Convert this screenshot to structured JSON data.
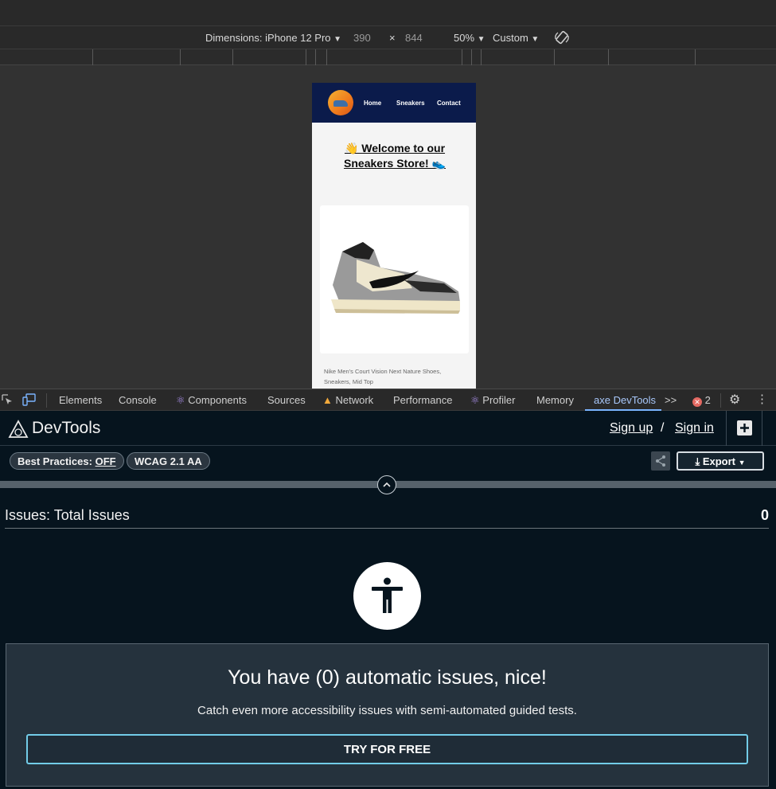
{
  "device_toolbar": {
    "dimensions_label": "Dimensions: iPhone 12 Pro",
    "width": "390",
    "times": "×",
    "height": "844",
    "zoom": "50%",
    "throttle": "Custom"
  },
  "site": {
    "nav": [
      "Home",
      "Sneakers",
      "Contact"
    ],
    "welcome_line1": "👋 Welcome to our",
    "welcome_line2": "Sneakers Store! 👟",
    "product_caption": "Nike Men's Court Vision Next Nature Shoes, Sneakers, Mid Top"
  },
  "devtools_tabs": {
    "items": [
      "Elements",
      "Console",
      "Components",
      "Sources",
      "Network",
      "Performance",
      "Profiler",
      "Memory",
      "axe DevTools"
    ],
    "active": "axe DevTools",
    "more": ">>",
    "error_count": "2"
  },
  "axe": {
    "title": "DevTools",
    "sign_up": "Sign up",
    "slash": "/",
    "sign_in": "Sign in",
    "best_practices_label": "Best Practices:",
    "best_practices_value": "OFF",
    "wcag": "WCAG 2.1 AA",
    "export": "Export",
    "issues_label": "Issues: Total Issues",
    "issues_count": "0",
    "panel_heading": "You have (0) automatic issues, nice!",
    "panel_sub": "Catch even more accessibility issues with semi-automated guided tests.",
    "try_button": "TRY FOR FREE"
  },
  "colors": {
    "axe_bg": "#06141e",
    "panel_bg": "#25323d",
    "accent": "#72cce8",
    "nav_bg": "#0b1b4b"
  }
}
